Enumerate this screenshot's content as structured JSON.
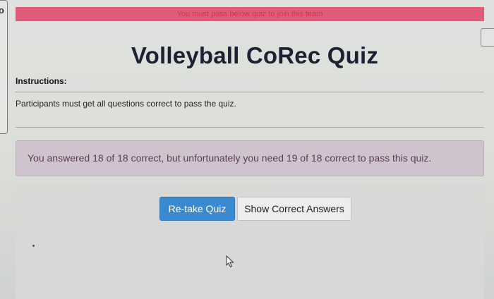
{
  "banner": {
    "text": "You must pass below quiz to join this team"
  },
  "quiz": {
    "title": "Volleyball CoRec Quiz",
    "instructions_label": "Instructions:",
    "instructions_text": "Participants must get all questions correct to pass the quiz."
  },
  "result": {
    "message": "You answered 18 of 18 correct, but unfortunately you need 19 of 18 correct to pass this quiz."
  },
  "actions": {
    "retake_label": "Re-take Quiz",
    "show_answers_label": "Show Correct Answers"
  },
  "left_panel": {
    "glyph": "o"
  },
  "colors": {
    "banner_bg": "#e05b77",
    "primary_button": "#3a8ad2",
    "result_bg": "#cfc4cd"
  },
  "icons": {
    "pointer": "mouse-pointer-icon"
  }
}
